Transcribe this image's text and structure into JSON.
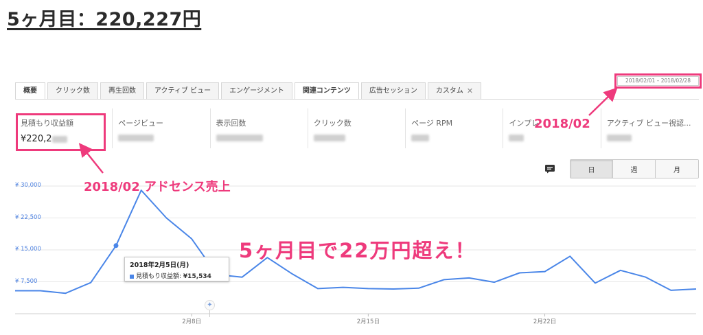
{
  "heading": "5ヶ月目：220,227円",
  "tabs": [
    {
      "label": "概要",
      "active": true
    },
    {
      "label": "クリック数"
    },
    {
      "label": "再生回数"
    },
    {
      "label": "アクティブ ビュー"
    },
    {
      "label": "エンゲージメント"
    },
    {
      "label": "関連コンテンツ",
      "active": true
    },
    {
      "label": "広告セッション"
    },
    {
      "label": "カスタム",
      "closable": true
    }
  ],
  "date_range": "2018/02/01 – 2018/02/28",
  "metrics": [
    {
      "label": "見積もり収益額",
      "value": "¥220,2"
    },
    {
      "label": "ページビュー"
    },
    {
      "label": "表示回数"
    },
    {
      "label": "クリック数"
    },
    {
      "label": "ページ RPM"
    },
    {
      "label": "インプレ"
    },
    {
      "label": "アクティブ ビュー視認..."
    }
  ],
  "annotations": {
    "revenue": "2018/02 アドセンス売上",
    "month": "2018/02",
    "headline": "5ヶ月目で22万円超え！"
  },
  "granularity": {
    "day": "日",
    "week": "週",
    "month": "月",
    "selected": "日"
  },
  "comment_icon": "comment-icon",
  "tooltip": {
    "date": "2018年2月5日(月)",
    "metric": "見積もり収益額:",
    "value": "¥15,534"
  },
  "colors": {
    "accent": "#ee3a7c",
    "line": "#4a86e8"
  },
  "chart_data": {
    "type": "line",
    "series": [
      {
        "name": "見積もり収益額",
        "values": [
          5400,
          5400,
          4800,
          7300,
          16000,
          29000,
          22500,
          17600,
          9200,
          8600,
          13200,
          9300,
          5900,
          6200,
          5900,
          5800,
          6000,
          8000,
          8400,
          7400,
          9600,
          9900,
          13500,
          7200,
          10200,
          8600,
          5500,
          5800
        ]
      }
    ],
    "x": [
      "2/1",
      "2/2",
      "2/3",
      "2/4",
      "2/5",
      "2/6",
      "2/7",
      "2/8",
      "2/9",
      "2/10",
      "2/11",
      "2/12",
      "2/13",
      "2/14",
      "2/15",
      "2/16",
      "2/17",
      "2/18",
      "2/19",
      "2/20",
      "2/21",
      "2/22",
      "2/23",
      "2/24",
      "2/25",
      "2/26",
      "2/27",
      "2/28"
    ],
    "xticks": [
      {
        "label": "2月8日",
        "index": 7
      },
      {
        "label": "2月15日",
        "index": 14
      },
      {
        "label": "2月22日",
        "index": 21
      }
    ],
    "yticks": [
      "¥ 30,000",
      "¥ 22,500",
      "¥ 15,000",
      "¥ 7,500"
    ],
    "ylim": [
      0,
      30000
    ],
    "highlight_index": 4,
    "grid": true
  }
}
